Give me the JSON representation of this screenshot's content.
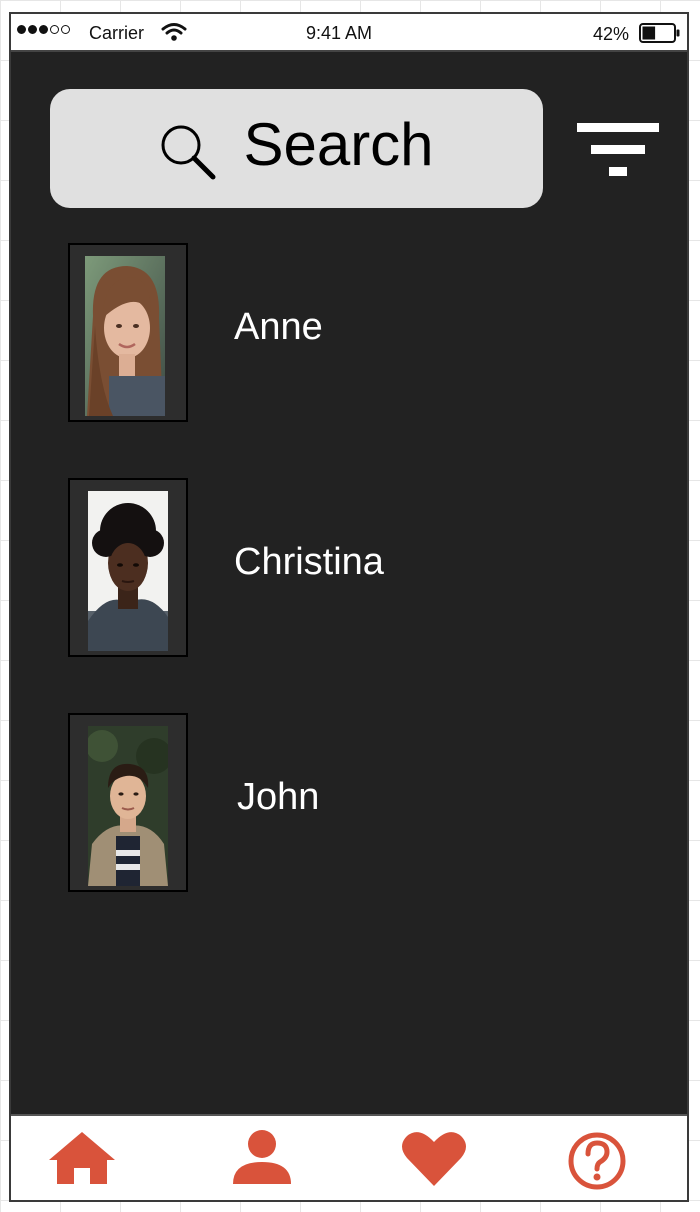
{
  "status_bar": {
    "carrier": "Carrier",
    "time": "9:41 AM",
    "battery_percent": "42%",
    "battery_level": 0.42,
    "signal_bars_filled": 3,
    "signal_bars_total": 5
  },
  "search": {
    "placeholder": "Search",
    "icon": "search-icon"
  },
  "filter": {
    "icon": "filter-icon"
  },
  "contacts": [
    {
      "name": "Anne",
      "photo": "avatar-photo"
    },
    {
      "name": "Christina",
      "photo": "avatar-photo"
    },
    {
      "name": "John",
      "photo": "avatar-photo"
    }
  ],
  "tab_bar": {
    "items": [
      {
        "icon": "home-icon"
      },
      {
        "icon": "user-icon"
      },
      {
        "icon": "heart-icon"
      },
      {
        "icon": "help-icon"
      }
    ]
  },
  "colors": {
    "background": "#222222",
    "search_field": "#e0e0e0",
    "accent": "#d9533b",
    "text_light": "#ffffff",
    "status_bar": "#ffffff"
  }
}
